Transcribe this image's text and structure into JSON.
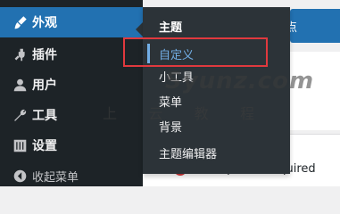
{
  "sidebar": {
    "items": [
      {
        "label": "外观",
        "icon": "paintbrush-icon",
        "active": true
      },
      {
        "label": "插件",
        "icon": "plugin-icon"
      },
      {
        "label": "用户",
        "icon": "user-icon"
      },
      {
        "label": "工具",
        "icon": "wrench-icon"
      },
      {
        "label": "设置",
        "icon": "settings-sliders-icon"
      }
    ],
    "collapse_label": "收起菜单"
  },
  "flyout": {
    "items": [
      "主题",
      "自定义",
      "小工具",
      "菜单",
      "背景",
      "主题编辑器"
    ],
    "highlighted": "自定义"
  },
  "content": {
    "button_label": "点",
    "notice_text": "PHP Update Required"
  },
  "watermark": {
    "main": "Syunz.com",
    "sub": [
      "上",
      "云",
      "教",
      "程"
    ]
  },
  "colors": {
    "sidebar_bg": "#1d2327",
    "active_bg": "#2271b1",
    "flyout_bg": "#2c3338",
    "highlight_border": "#e0393e"
  }
}
